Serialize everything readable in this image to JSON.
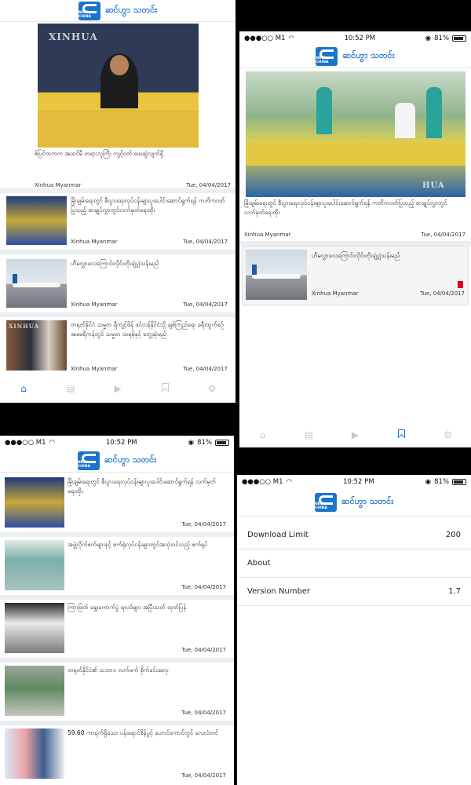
{
  "app": {
    "brand_text": "ဆင်ဟွာ သတင်း",
    "logo_text": "NEW CHINA",
    "accent": "#1b74c9"
  },
  "status": {
    "carrier": "●●●○○ M1",
    "wifi": "wifi-icon",
    "time": "10:52 PM",
    "battery": "81%"
  },
  "screen1": {
    "featured": {
      "watermark": "XINHUA",
      "title": "ဧ်ပြင်တကက အထင်မီ တရားသူကြီး ကျင့်ဝတ် ဖေးဆွဲလျက်ရှိ",
      "source": "Xinhua Myanmar",
      "date": "Tue, 04/04/2017"
    },
    "items": [
      {
        "title": "မြိုးချမ်းရေးတွင် စီးပွားရေးလုပ်ငန်းများပူးပေါင်းဆောင်ရွက်ရန် ကတိကဝတ်ပြုသည့် စာချုပ်လွှာတွင်လက်မှတ်ရေးထိုး",
        "source": "Xinhua Myanmar",
        "date": "Tue, 04/04/2017"
      },
      {
        "title": "ဟီမလွှာလေကြောင်းလိုင်းတိုးချဲ့ပျံသန်းမည်",
        "source": "Xinhua Myanmar",
        "date": "Tue, 04/04/2017"
      },
      {
        "title": "တရုတ်နိုင်ငံ သမ္မတ ရှီကျင့်ဖိန် ဖင်လန်နိုင်ငံသို့ ချစ်ကြည်ရေး ခရီးထွက်စဉ် အမေရိကန်တွင် သမ္မတ ထရမ့်နှင့် တွေ့ဆုံမည်",
        "source": "Xinhua Myanmar",
        "date": "Tue, 04/04/2017"
      }
    ]
  },
  "screen2": {
    "featured": {
      "watermark": "HUA",
      "title": "မြိုးချမ်းရေးတွင် စီးပွားရေးလုပ်ငန်းများပူးပေါင်းဆောင်ရွက်ရန် ကတိကဝတ်ပြုသည့် စာချုပ်လွှာတွင်လက်မှတ်ရေးထိုး",
      "source": "Xinhua Myanmar",
      "date": "Tue, 04/04/2017"
    },
    "items": [
      {
        "title": "ဟီမလွှာလေကြောင်းလိုင်းတိုးချဲ့ပျံသန်းမည်",
        "source": "Xinhua Myanmar",
        "date": "Tue, 04/04/2017"
      }
    ]
  },
  "screen3": {
    "items": [
      {
        "title": "မြိုးချမ်းရေးတွင် စီးပွားရေးလုပ်ငန်းများပူးပေါင်းဆောင်ရွက်ရန် လက်မှတ်ရေးထိုး",
        "date": "Tue, 04/04/2017"
      },
      {
        "title": "အဖွဲ့လိုက်စက်များနှင့် စက်ရုံလုပ်ငန်းများတွင်အသုံးဝင်သည့် စက်ရုပ်",
        "date": "Tue, 04/04/2017"
      },
      {
        "title": "ကြားဖြတ် ရွေးကောက်ပွဲ ရလဒ်များ အပြီးသတ် ထုတ်ပြန်",
        "date": "Tue, 04/04/2017"
      },
      {
        "title": "တရုတ်နိုင်ငံ၏ သဘာဝ လက်ဖက် စိုက်ခင်းအလှ",
        "date": "Tue, 04/04/2017"
      },
      {
        "title": "59.60 ကာရက်ရှိသော ပန်းရောင်စိန်ပွင့် ဟောင်ကောင်တွင် လေလံတင်",
        "date": "Tue, 04/04/2017"
      }
    ]
  },
  "settings": {
    "rows": [
      {
        "label": "Download Limit",
        "value": "200"
      },
      {
        "label": "About",
        "value": ""
      },
      {
        "label": "Version Number",
        "value": "1.7"
      }
    ]
  },
  "tabs": [
    "home-icon",
    "news-icon",
    "video-icon",
    "bookmark-icon",
    "settings-icon"
  ]
}
